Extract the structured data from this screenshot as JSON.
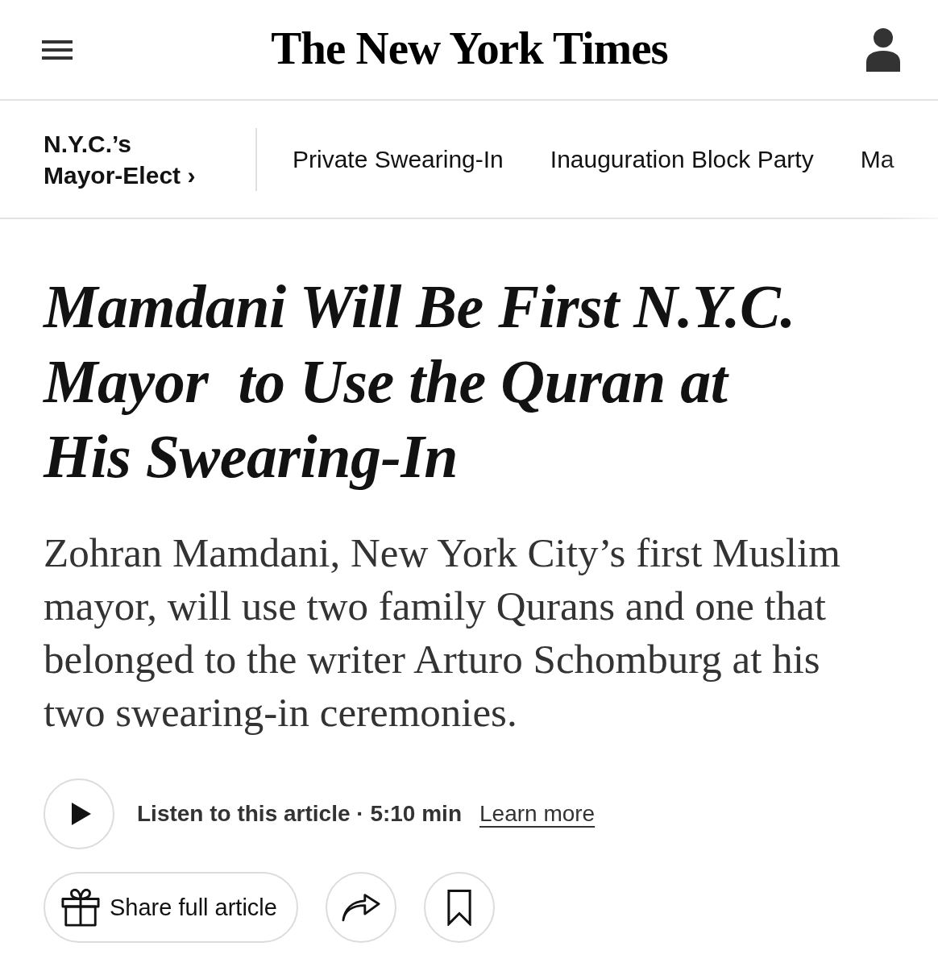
{
  "header": {
    "logo": "The New York Times"
  },
  "section_nav": {
    "title_lines": [
      "N.Y.C.’s",
      "Mayor-Elect ›"
    ],
    "items": [
      {
        "label": "Private Swearing-In"
      },
      {
        "label": "Inauguration Block Party"
      },
      {
        "label": "Ma"
      }
    ]
  },
  "article": {
    "headline": "Mamdani Will Be First N.Y.C. Mayor  to Use the Quran at His Swearing-In",
    "summary": "Zohran Mamdani, New York City’s first Muslim mayor, will use two family Qurans and one that belonged to the writer Arturo Schomburg at his two swearing-in ceremonies."
  },
  "listen": {
    "label": "Listen to this article · 5:10 min",
    "link": "Learn more"
  },
  "actions": {
    "share_label": "Share full article"
  }
}
